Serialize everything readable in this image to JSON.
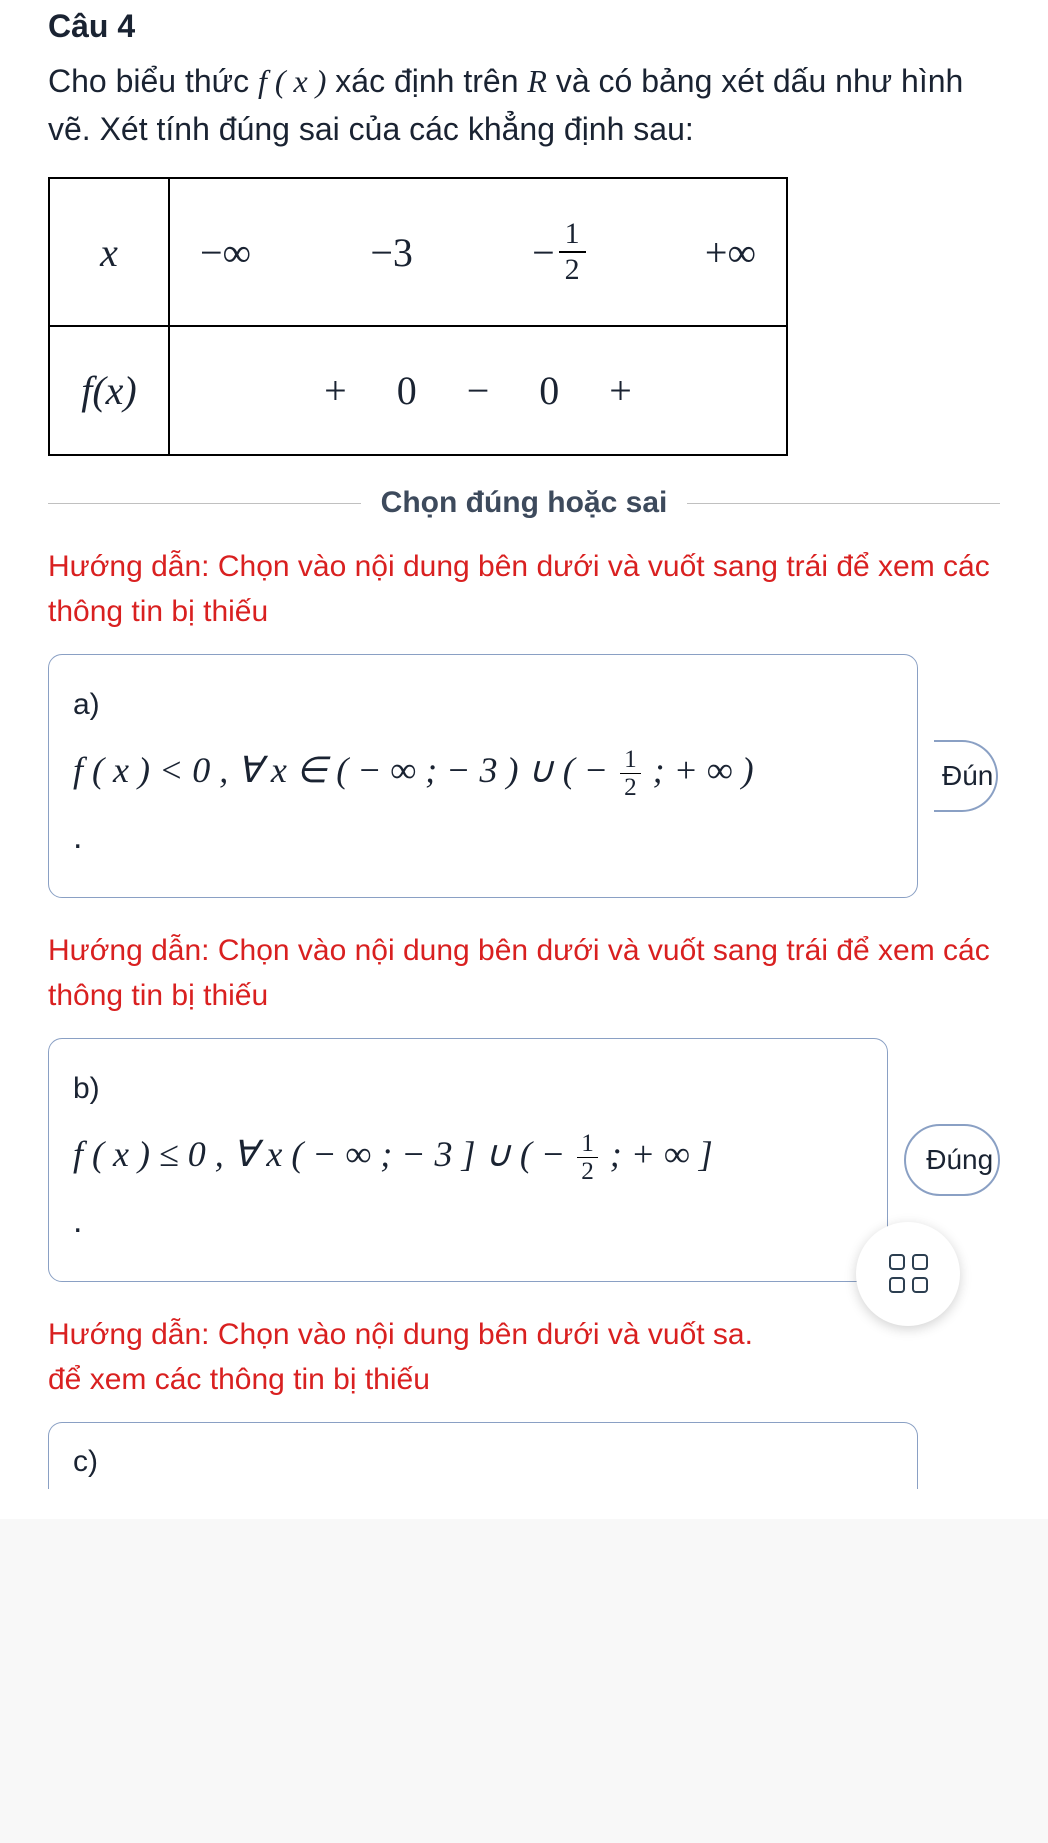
{
  "question": {
    "number": "Câu 4",
    "text_parts": {
      "p1": "Cho biểu thức ",
      "fx": "f ( x )",
      "p2": " xác định trên ",
      "R": "R",
      "p3": " và có bảng xét dấu như hình vẽ. Xét tính đúng sai của các khẳng định sau:"
    }
  },
  "sign_table": {
    "row1_label": "x",
    "row1_values": [
      "−∞",
      "−3",
      "−½",
      "+∞"
    ],
    "row2_label": "f(x)",
    "row2_values": [
      "+",
      "0",
      "−",
      "0",
      "+"
    ]
  },
  "divider_label": "Chọn đúng hoặc sai",
  "hint": "Hướng dẫn: Chọn vào nội dung bên dưới và vuốt sang trái để xem các thông tin bị thiếu",
  "options": {
    "a": {
      "label": "a)",
      "math_prefix": "f ( x ) < 0 , ∀ x ∈ ( − ∞ ; − 3 ) ∪ ( − ",
      "math_suffix": " ; + ∞ )",
      "pill": "Đún"
    },
    "b": {
      "label": "b)",
      "math_prefix": "f ( x ) ≤ 0 , ∀ x ( − ∞ ; − 3 ] ∪ ( − ",
      "math_suffix": " ; + ∞ ]",
      "pill": "Đúng"
    },
    "c": {
      "label": "c)"
    }
  },
  "hint_truncated": "Hướng dẫn: Chọn vào nội dung bên dưới và vuốt sa.",
  "hint_line2": "để xem các thông tin bị thiếu",
  "frac": {
    "num": "1",
    "den": "2"
  }
}
